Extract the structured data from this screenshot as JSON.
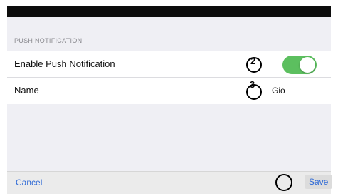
{
  "section": {
    "header": "PUSH NOTIFICATION"
  },
  "rows": {
    "enable_push": {
      "label": "Enable Push Notification",
      "toggle_on": true,
      "annotation": "2"
    },
    "name": {
      "label": "Name",
      "value": "Gio",
      "annotation": "3"
    }
  },
  "footer": {
    "cancel_label": "Cancel",
    "save_label": "Save"
  },
  "colors": {
    "toggle_on": "#5cbf5f",
    "link": "#2f6ad6",
    "background": "#efeff4"
  }
}
